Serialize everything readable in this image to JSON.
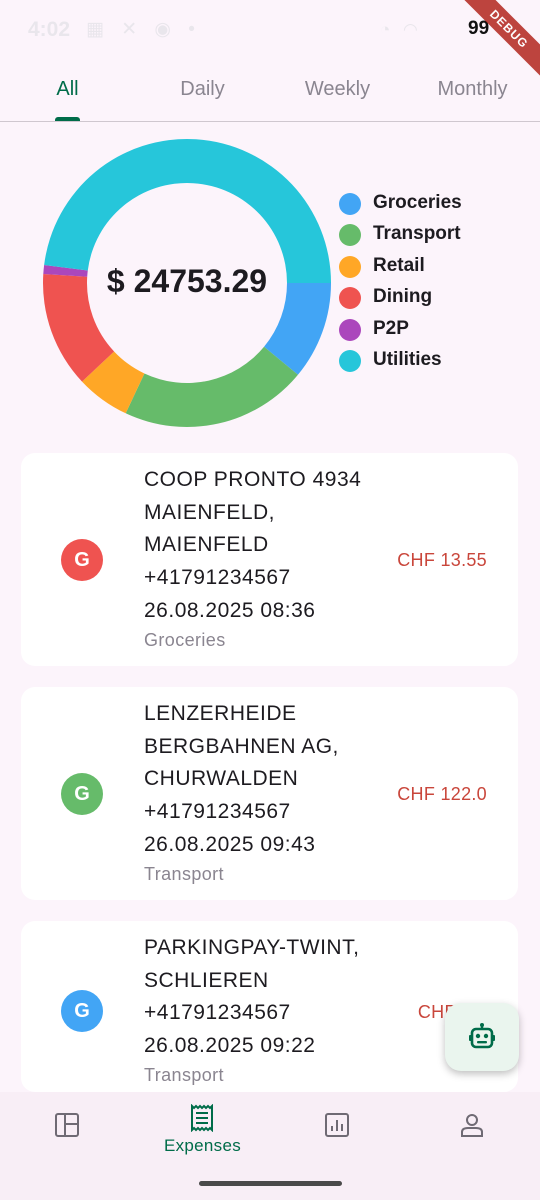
{
  "status": {
    "time": "4:02",
    "left_icons": "▦ ✕ ◉ •",
    "right_icons": "◔ ◠",
    "battery": "99",
    "debug_label": "DEBUG"
  },
  "tabs": [
    {
      "label": "All",
      "active": true
    },
    {
      "label": "Daily",
      "active": false
    },
    {
      "label": "Weekly",
      "active": false
    },
    {
      "label": "Monthly",
      "active": false
    }
  ],
  "chart_data": {
    "type": "pie",
    "title": "$ 24753.29",
    "donut": true,
    "categories": [
      "Groceries",
      "Transport",
      "Retail",
      "Dining",
      "P2P",
      "Utilities"
    ],
    "values": [
      11,
      21,
      6,
      13,
      1,
      48
    ],
    "colors": [
      "#42a5f5",
      "#66bb6a",
      "#ffa726",
      "#ef5350",
      "#ab47bc",
      "#26c6da"
    ],
    "legend_position": "right"
  },
  "transactions": [
    {
      "merchant": "COOP PRONTO 4934 MAIENFELD, MAIENFELD +41791234567 26.08.2025 08:36",
      "category": "Groceries",
      "amount": "CHF 13.55",
      "avatar_letter": "G",
      "avatar_color": "#ef5350"
    },
    {
      "merchant": "LENZERHEIDE BERGBAHNEN AG, CHURWALDEN +41791234567 26.08.2025 09:43",
      "category": "Transport",
      "amount": "CHF 122.0",
      "avatar_letter": "G",
      "avatar_color": "#66bb6a"
    },
    {
      "merchant": "PARKINGPAY-TWINT, SCHLIEREN +41791234567 26.08.2025 09:22",
      "category": "Transport",
      "amount": "CHF 8.0",
      "avatar_letter": "G",
      "avatar_color": "#42a5f5"
    }
  ],
  "fab": {
    "icon": "robot-icon"
  },
  "bottom_nav": [
    {
      "icon": "dashboard-icon",
      "label": "",
      "active": false
    },
    {
      "icon": "receipt-icon",
      "label": "Expenses",
      "active": true
    },
    {
      "icon": "chart-icon",
      "label": "",
      "active": false
    },
    {
      "icon": "profile-icon",
      "label": "",
      "active": false
    }
  ],
  "colors": {
    "accent": "#006c49",
    "amount": "#c9463b",
    "background": "#fcf4fb"
  }
}
